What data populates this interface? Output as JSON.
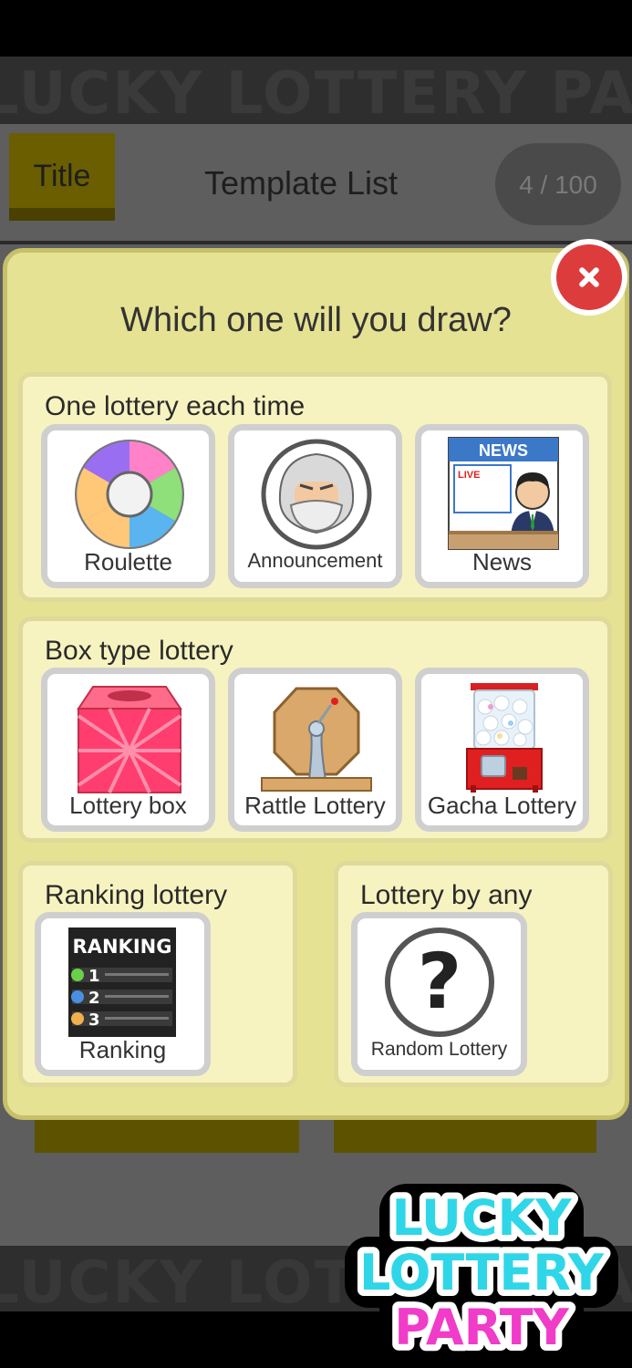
{
  "background": {
    "marquee_text": "LUCKY LOTTERY PARTY LUCKY LOTTERY PARTY",
    "title_button": "Title",
    "header_title": "Template List",
    "counter": "4 / 100"
  },
  "dialog": {
    "title": "Which one will you draw?",
    "sections": [
      {
        "title": "One lottery each time",
        "items": [
          {
            "label": "Roulette",
            "icon": "roulette-wheel-icon"
          },
          {
            "label": "Announcement",
            "icon": "old-man-icon"
          },
          {
            "label": "News",
            "icon": "news-anchor-icon",
            "badge_news": "NEWS",
            "badge_live": "LIVE"
          }
        ]
      },
      {
        "title": "Box type lottery",
        "items": [
          {
            "label": "Lottery box",
            "icon": "lottery-box-icon"
          },
          {
            "label": "Rattle Lottery",
            "icon": "rattle-lottery-icon"
          },
          {
            "label": "Gacha Lottery",
            "icon": "gacha-machine-icon"
          }
        ]
      },
      {
        "title": "Ranking lottery",
        "items": [
          {
            "label": "Ranking",
            "icon": "ranking-board-icon",
            "board_title": "RANKING",
            "ranks": [
              "1",
              "2",
              "3"
            ]
          }
        ]
      },
      {
        "title": "Lottery by any",
        "items": [
          {
            "label": "Random Lottery",
            "icon": "question-mark-icon",
            "symbol": "?"
          }
        ]
      }
    ]
  },
  "logo": {
    "lines": [
      "LUCKY",
      "LOTTERY",
      "PARTY"
    ]
  },
  "colors": {
    "dialog_bg": "#e6e293",
    "section_bg": "#f7f3c0",
    "close_red": "#dd3c3c",
    "logo_cyan": "#2fd6e8",
    "logo_pink": "#f03cc8"
  }
}
